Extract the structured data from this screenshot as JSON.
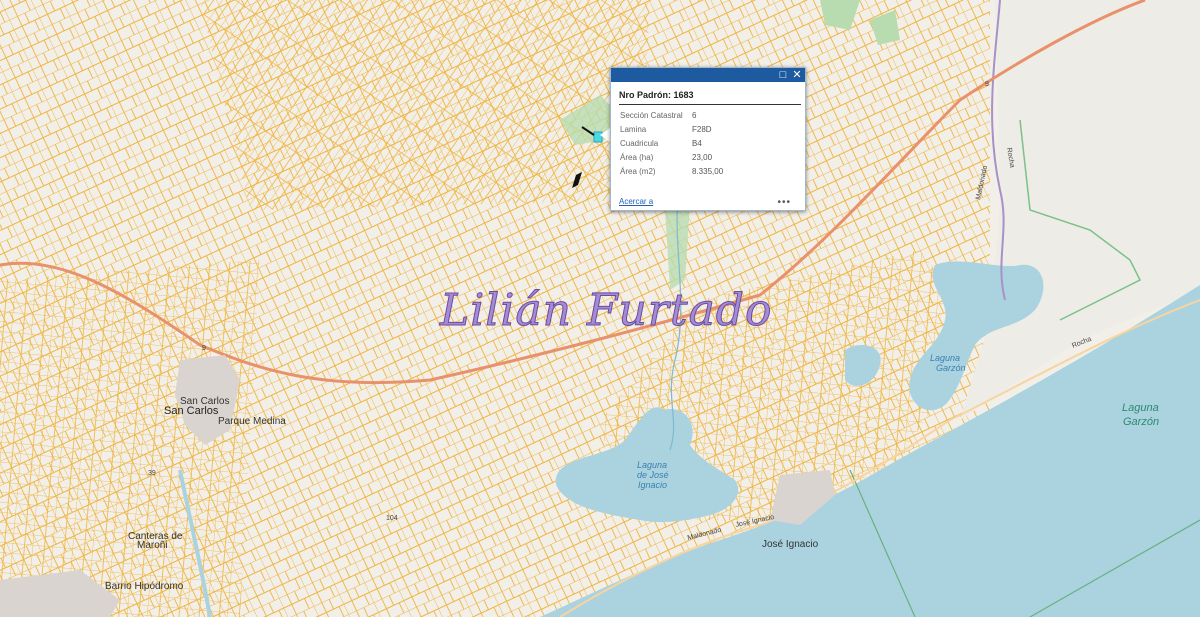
{
  "popup": {
    "title": "Nro Padrón: 1683",
    "fields": [
      {
        "label": "Sección Catastral",
        "value": "6"
      },
      {
        "label": "Lamina",
        "value": "F28D"
      },
      {
        "label": "Cuadricula",
        "value": "B4"
      },
      {
        "label": "Área (ha)",
        "value": "23,00"
      },
      {
        "label": "Área (m2)",
        "value": "8.335,00"
      }
    ],
    "zoom_link": "Acercar a",
    "more": "•••",
    "maximize_icon": "maximize-icon",
    "close_icon": "close-icon"
  },
  "watermark": "Lilián Furtado",
  "map_labels": {
    "laguna_garzon_small": [
      "Laguna",
      "Garzón"
    ],
    "laguna_garzon_big": [
      "Laguna",
      "Garzón"
    ],
    "laguna_jose_ignacio": [
      "Laguna",
      "de José",
      "Ignacio"
    ],
    "jose_ignacio_upper": "José Ignacio",
    "jose_ignacio_lower": "José Ignacio",
    "maldonado": "Maldonado",
    "rocha_road": "Rocha",
    "rocha_vertical": "Rocha",
    "maldonado_vertical": "Maldonado",
    "san_carlos_small": "San Carlos",
    "san_carlos": "San Carlos",
    "parque_medina": "Parque Medina",
    "canteras_de": "Canteras de",
    "maroni": "Maroñi",
    "barrio_hipodromo": "Barrio Hipódromo",
    "route_9_a": "9",
    "route_9_b": "9",
    "route_39": "39",
    "route_104": "104"
  },
  "colors": {
    "land": "#f2efe9",
    "sea": "#aad3df",
    "parcel": "#f0b43c",
    "road": "#e8916a",
    "park": "#b8dcb0",
    "header": "#1e5aa0"
  }
}
